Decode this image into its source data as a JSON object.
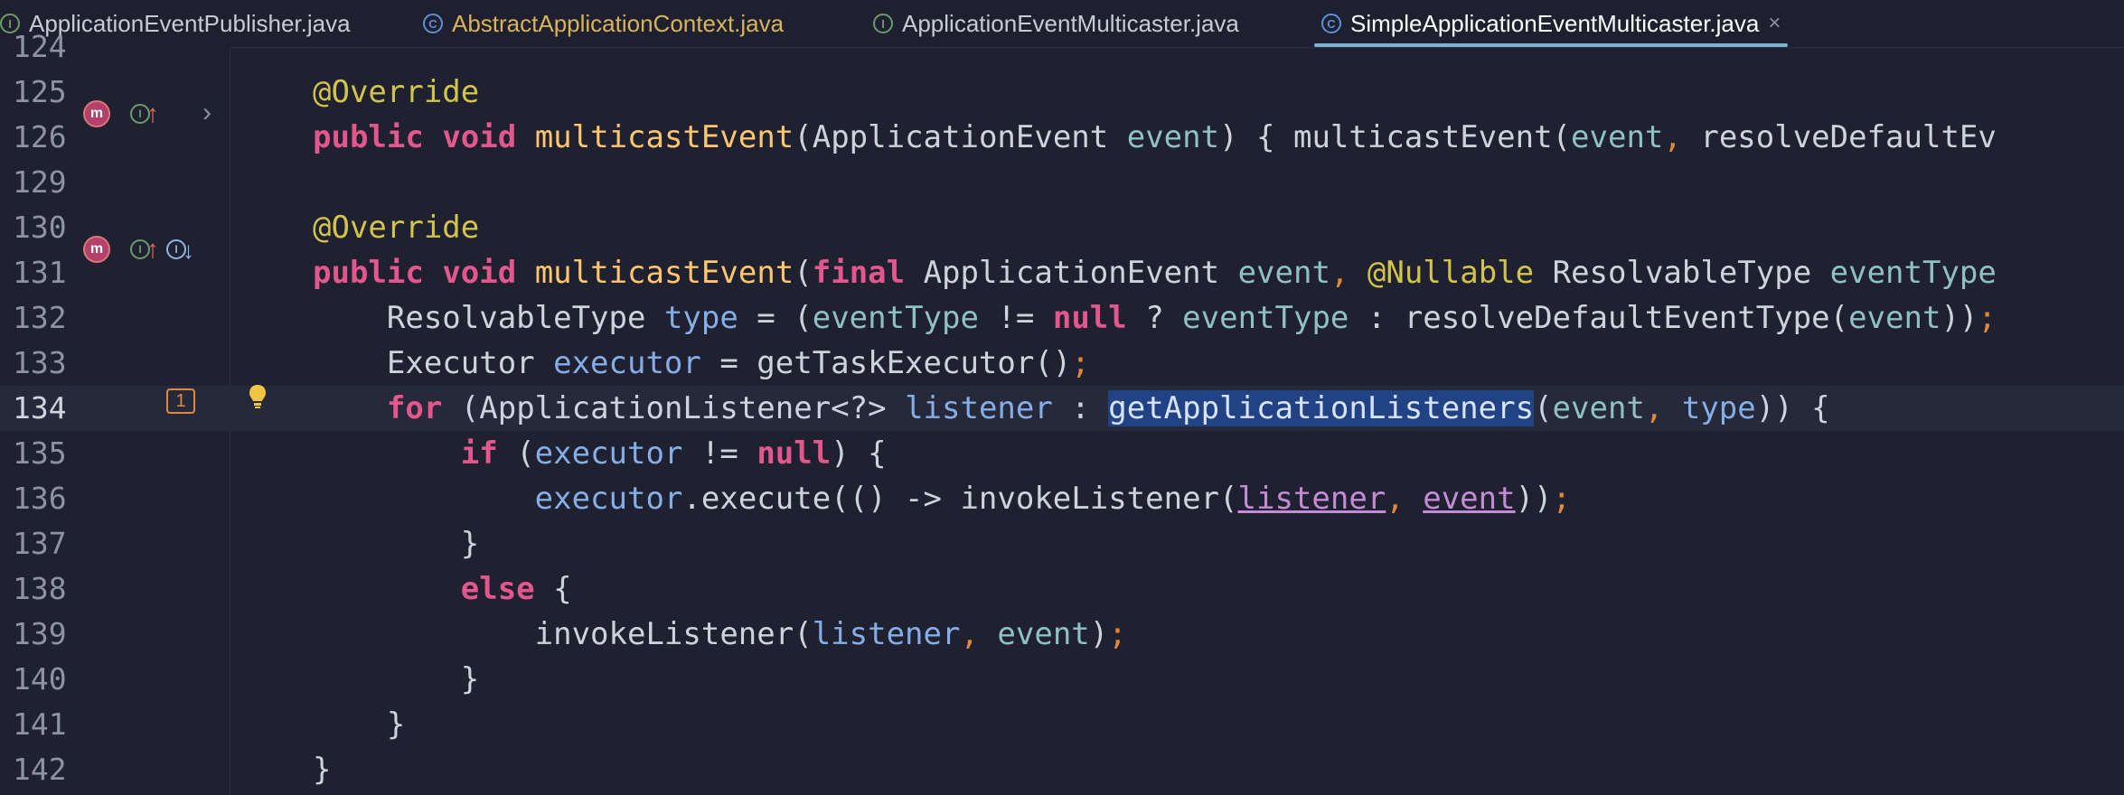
{
  "tabs": [
    {
      "label": "ApplicationEventPublisher.java",
      "icon": "interface-icon",
      "icon_glyph": "I",
      "color": "#c7cbd6"
    },
    {
      "label": "AbstractApplicationContext.java",
      "icon": "class-icon",
      "icon_glyph": "C",
      "color": "#d8b35a"
    },
    {
      "label": "ApplicationEventMulticaster.java",
      "icon": "interface-icon",
      "icon_glyph": "I",
      "color": "#c7cbd6"
    },
    {
      "label": "SimpleApplicationEventMulticaster.java",
      "icon": "class-icon",
      "icon_glyph": "C",
      "color": "#ffffff",
      "active": true,
      "close": "×"
    }
  ],
  "gutter": {
    "method_glyph": "m",
    "interface_glyph": "I",
    "up_arrow": "↑",
    "down_arrow": "↓",
    "chevron": "›",
    "badge_134": "1"
  },
  "lines": [
    {
      "num": "124"
    },
    {
      "num": "125",
      "tokens": [
        {
          "t": "@Override",
          "c": "a"
        }
      ]
    },
    {
      "num": "126",
      "tokens": [
        {
          "t": "public",
          "c": "k"
        },
        {
          "t": " "
        },
        {
          "t": "void",
          "c": "k"
        },
        {
          "t": " "
        },
        {
          "t": "multicastEvent",
          "c": "m"
        },
        {
          "t": "(ApplicationEvent "
        },
        {
          "t": "event",
          "c": "p"
        },
        {
          "t": ") { multicastEvent("
        },
        {
          "t": "event",
          "c": "p"
        },
        {
          "t": ", ",
          "c": "o"
        },
        {
          "t": "resolveDefaultEv"
        }
      ]
    },
    {
      "num": "129"
    },
    {
      "num": "130",
      "tokens": [
        {
          "t": "@Override",
          "c": "a"
        }
      ]
    },
    {
      "num": "131",
      "tokens": [
        {
          "t": "public",
          "c": "k"
        },
        {
          "t": " "
        },
        {
          "t": "void",
          "c": "k"
        },
        {
          "t": " "
        },
        {
          "t": "multicastEvent",
          "c": "m"
        },
        {
          "t": "("
        },
        {
          "t": "final",
          "c": "k"
        },
        {
          "t": " ApplicationEvent "
        },
        {
          "t": "event",
          "c": "p"
        },
        {
          "t": ", ",
          "c": "o"
        },
        {
          "t": "@Nullable",
          "c": "a"
        },
        {
          "t": " ResolvableType "
        },
        {
          "t": "eventType",
          "c": "p"
        }
      ]
    },
    {
      "num": "132",
      "tokens": [
        {
          "t": "    ResolvableType "
        },
        {
          "t": "type",
          "c": "f"
        },
        {
          "t": " = ("
        },
        {
          "t": "eventType",
          "c": "p"
        },
        {
          "t": " != "
        },
        {
          "t": "null",
          "c": "k"
        },
        {
          "t": " ? "
        },
        {
          "t": "eventType",
          "c": "p"
        },
        {
          "t": " : resolveDefaultEventType("
        },
        {
          "t": "event",
          "c": "p"
        },
        {
          "t": "))"
        },
        {
          "t": ";",
          "c": "o"
        }
      ]
    },
    {
      "num": "133",
      "tokens": [
        {
          "t": "    Executor "
        },
        {
          "t": "executor",
          "c": "f"
        },
        {
          "t": " = getTaskExecutor()"
        },
        {
          "t": ";",
          "c": "o"
        }
      ]
    },
    {
      "num": "134",
      "current": true,
      "tokens": [
        {
          "t": "    "
        },
        {
          "t": "for",
          "c": "k"
        },
        {
          "t": " (ApplicationListener<?> "
        },
        {
          "t": "listener",
          "c": "f"
        },
        {
          "t": " : "
        },
        {
          "t": "getApplicationListeners",
          "c": "sel"
        },
        {
          "t": "("
        },
        {
          "t": "event",
          "c": "p"
        },
        {
          "t": ", ",
          "c": "o"
        },
        {
          "t": "type",
          "c": "f"
        },
        {
          "t": ")) {"
        }
      ]
    },
    {
      "num": "135",
      "tokens": [
        {
          "t": "        "
        },
        {
          "t": "if",
          "c": "k"
        },
        {
          "t": " ("
        },
        {
          "t": "executor",
          "c": "f"
        },
        {
          "t": " != "
        },
        {
          "t": "null",
          "c": "k"
        },
        {
          "t": ") {"
        }
      ]
    },
    {
      "num": "136",
      "tokens": [
        {
          "t": "            "
        },
        {
          "t": "executor",
          "c": "f"
        },
        {
          "t": ".execute(() -> invokeListener("
        },
        {
          "t": "listener",
          "c": "u"
        },
        {
          "t": ", ",
          "c": "o"
        },
        {
          "t": "event",
          "c": "u"
        },
        {
          "t": "))"
        },
        {
          "t": ";",
          "c": "o"
        }
      ]
    },
    {
      "num": "137",
      "tokens": [
        {
          "t": "        }"
        }
      ]
    },
    {
      "num": "138",
      "tokens": [
        {
          "t": "        "
        },
        {
          "t": "else",
          "c": "k"
        },
        {
          "t": " {"
        }
      ]
    },
    {
      "num": "139",
      "tokens": [
        {
          "t": "            invokeListener("
        },
        {
          "t": "listener",
          "c": "f"
        },
        {
          "t": ", ",
          "c": "o"
        },
        {
          "t": "event",
          "c": "p"
        },
        {
          "t": ")"
        },
        {
          "t": ";",
          "c": "o"
        }
      ]
    },
    {
      "num": "140",
      "tokens": [
        {
          "t": "        }"
        }
      ]
    },
    {
      "num": "141",
      "tokens": [
        {
          "t": "    }"
        }
      ]
    },
    {
      "num": "142",
      "tokens": [
        {
          "t": "}"
        }
      ]
    }
  ]
}
